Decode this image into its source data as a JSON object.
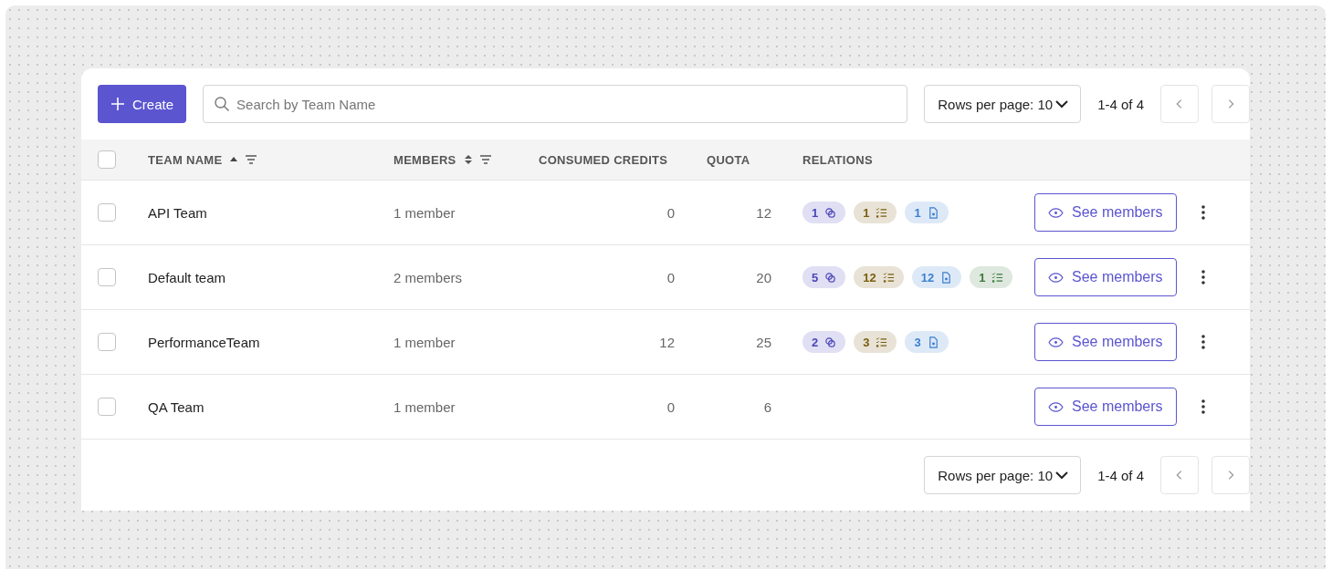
{
  "toolbar": {
    "create_button": "Create",
    "search": {
      "placeholder": "Search by Team Name"
    },
    "rows_per_page": "Rows per page: 10",
    "range": "1-4 of 4"
  },
  "table": {
    "select_all": {
      "checked": false
    },
    "columns": [
      {
        "label": "TEAM NAME",
        "sortable": true,
        "sorted_ascending": true,
        "filterable": true
      },
      {
        "label": "MEMBERS",
        "sortable": true,
        "sorted_ascending": false,
        "filterable": true
      },
      {
        "label": "CONSUMED CREDITS",
        "sortable": false,
        "filterable": false
      },
      {
        "label": "QUOTA",
        "sortable": false,
        "filterable": false
      },
      {
        "label": "RELATIONS",
        "sortable": false,
        "filterable": false
      }
    ],
    "rows": [
      {
        "checked": false,
        "name": "API Team",
        "members": "1 member",
        "credits": "0",
        "quota": "12",
        "relations": [
          {
            "count": "1",
            "kind": "link",
            "color": "#4b45b8"
          },
          {
            "count": "1",
            "kind": "checklist",
            "color": "#7a5d10"
          },
          {
            "count": "1",
            "kind": "document",
            "color": "#3b7fd0"
          }
        ],
        "action": "See members"
      },
      {
        "checked": false,
        "name": "Default team",
        "members": "2 members",
        "credits": "0",
        "quota": "20",
        "relations": [
          {
            "count": "5",
            "kind": "link",
            "color": "#4b45b8"
          },
          {
            "count": "12",
            "kind": "checklist",
            "color": "#7a5d10"
          },
          {
            "count": "12",
            "kind": "document",
            "color": "#3b7fd0"
          },
          {
            "count": "1",
            "kind": "checklist",
            "color": "#3a7a3a"
          }
        ],
        "action": "See members"
      },
      {
        "checked": false,
        "name": "PerformanceTeam",
        "members": "1 member",
        "credits": "12",
        "quota": "25",
        "relations": [
          {
            "count": "2",
            "kind": "link",
            "color": "#4b45b8"
          },
          {
            "count": "3",
            "kind": "checklist",
            "color": "#7a5d10"
          },
          {
            "count": "3",
            "kind": "document",
            "color": "#3b7fd0"
          }
        ],
        "action": "See members"
      },
      {
        "checked": false,
        "name": "QA Team",
        "members": "1 member",
        "credits": "0",
        "quota": "6",
        "action": "See members"
      }
    ]
  },
  "footer": {
    "rows_per_page": "Rows per page: 10",
    "range": "1-4 of 4"
  }
}
